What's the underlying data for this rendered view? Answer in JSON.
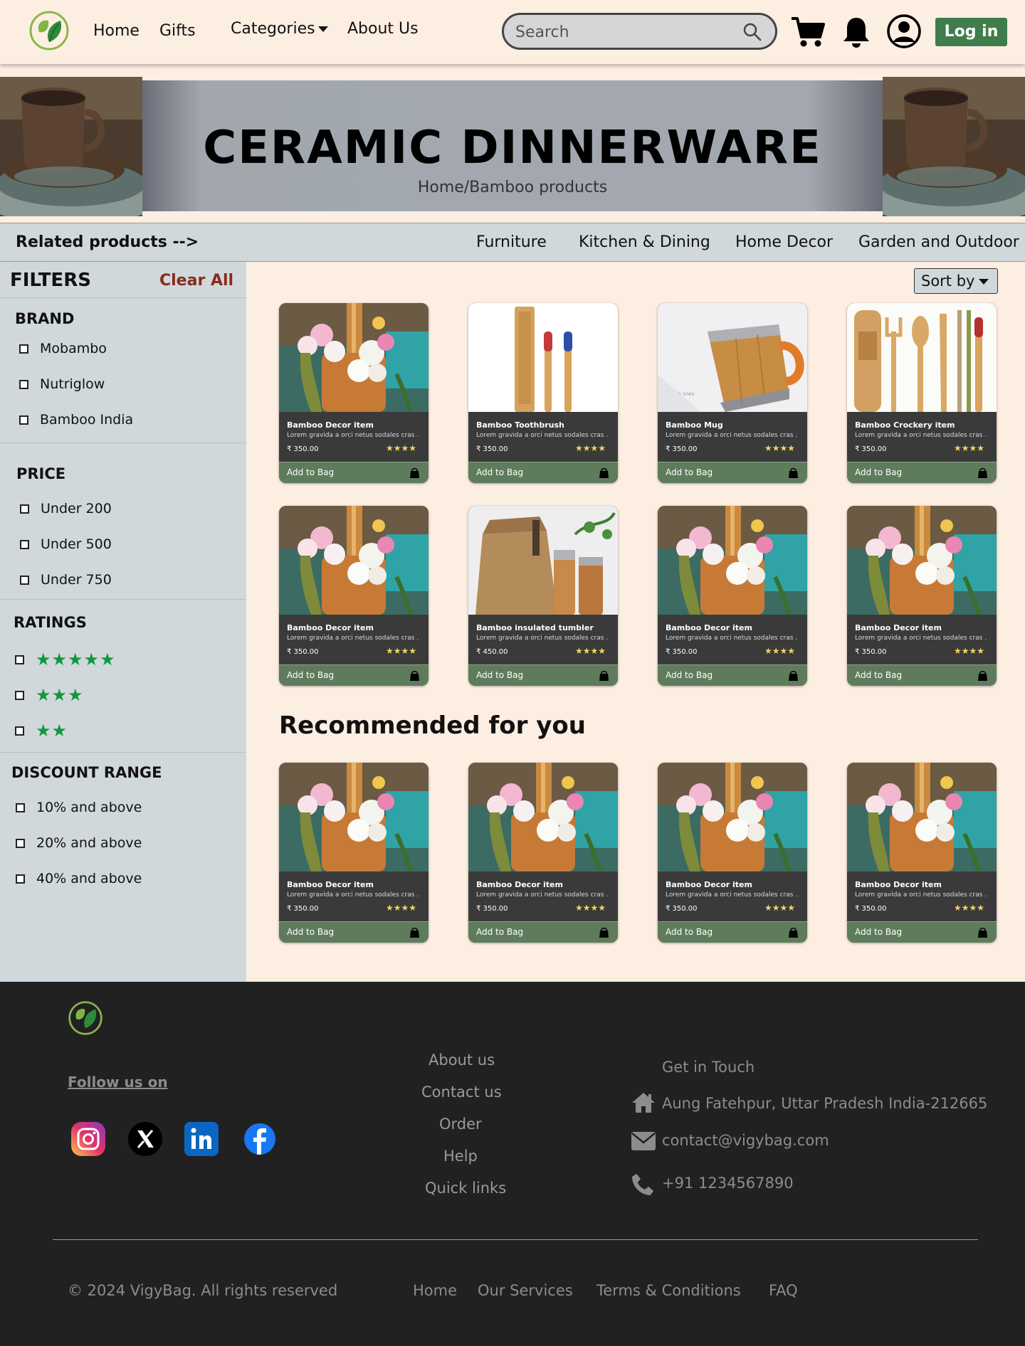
{
  "nav": {
    "links": [
      "Home",
      "Gifts",
      "Categories",
      "About Us"
    ],
    "search_placeholder": "Search",
    "login_label": "Log in",
    "accent": "#3f7d4c"
  },
  "hero": {
    "title": "CERAMIC DINNERWARE",
    "breadcrumb": "Home/Bamboo products"
  },
  "related": {
    "title": "Related products -->",
    "links": [
      "Furniture",
      "Kitchen & Dining",
      "Home Decor",
      "Garden and Outdoor"
    ]
  },
  "filters": {
    "title": "FILTERS",
    "clear": "Clear All",
    "brand": {
      "heading": "BRAND",
      "options": [
        "Mobambo",
        "Nutriglow",
        "Bamboo India"
      ]
    },
    "price": {
      "heading": "PRICE",
      "options": [
        "Under 200",
        "Under 500",
        "Under 750"
      ]
    },
    "ratings": {
      "heading": "RATINGS",
      "options": [
        "★★★★★",
        "★★★",
        "★★"
      ]
    },
    "discount": {
      "heading": "DISCOUNT RANGE",
      "options": [
        "10% and above",
        "20% and above",
        "40% and above"
      ]
    }
  },
  "sort_label": "Sort by",
  "products": [
    {
      "name": "Bamboo Decor item",
      "desc": "Lorem gravida a orci netus sodales cras .",
      "price": "₹ 350.00",
      "stars": "★★★★",
      "image": "flowers"
    },
    {
      "name": "Bamboo Toothbrush",
      "desc": "Lorem gravida a orci netus sodales cras .",
      "price": "₹ 350.00",
      "stars": "★★★★",
      "image": "toothbrush"
    },
    {
      "name": "Bamboo Mug",
      "desc": "Lorem gravida a orci netus sodales cras .",
      "price": "₹ 350.00",
      "stars": "★★★★",
      "image": "mug"
    },
    {
      "name": "Bamboo Crockery item",
      "desc": "Lorem gravida a orci netus sodales cras .",
      "price": "₹ 350.00",
      "stars": "★★★★",
      "image": "crockery"
    },
    {
      "name": "Bamboo Decor item",
      "desc": "Lorem gravida a orci netus sodales cras .",
      "price": "₹ 350.00",
      "stars": "★★★★",
      "image": "flowers"
    },
    {
      "name": "Bamboo insulated tumbler",
      "desc": "Lorem gravida a orci netus sodales cras .",
      "price": "₹ 450.00",
      "stars": "★★★★",
      "image": "tumbler"
    },
    {
      "name": "Bamboo Decor item",
      "desc": "Lorem gravida a orci netus sodales cras .",
      "price": "₹ 350.00",
      "stars": "★★★★",
      "image": "flowers"
    },
    {
      "name": "Bamboo Decor item",
      "desc": "Lorem gravida a orci netus sodales cras .",
      "price": "₹ 350.00",
      "stars": "★★★★",
      "image": "flowers"
    }
  ],
  "recommended": {
    "title": "Recommended for you",
    "items": [
      {
        "name": "Bamboo Decor item",
        "desc": "Lorem gravida a orci netus sodales cras .",
        "price": "₹ 350.00",
        "stars": "★★★★",
        "image": "flowers"
      },
      {
        "name": "Bamboo Decor item",
        "desc": "Lorem gravida a orci netus sodales cras .",
        "price": "₹ 350.00",
        "stars": "★★★★",
        "image": "flowers"
      },
      {
        "name": "Bamboo Decor item",
        "desc": "Lorem gravida a orci netus sodales cras .",
        "price": "₹ 350.00",
        "stars": "★★★★",
        "image": "flowers"
      },
      {
        "name": "Bamboo Decor item",
        "desc": "Lorem gravida a orci netus sodales cras .",
        "price": "₹ 350.00",
        "stars": "★★★★",
        "image": "flowers"
      }
    ]
  },
  "add_to_bag": "Add to Bag",
  "footer": {
    "follow": "Follow us on",
    "social": [
      "instagram-icon",
      "x-icon",
      "linkedin-icon",
      "facebook-icon"
    ],
    "links": [
      "About us",
      "Contact us",
      "Order",
      "Help",
      "Quick links"
    ],
    "get_in_touch": "Get in Touch",
    "address": "Aung Fatehpur, Uttar Pradesh India-212665",
    "email": "contact@vigybag.com",
    "phone": "+91 1234567890",
    "copyright": "© 2024 VigyBag. All rights reserved",
    "bottom_links": [
      "Home",
      "Our Services",
      "Terms & Conditions",
      "FAQ"
    ]
  }
}
